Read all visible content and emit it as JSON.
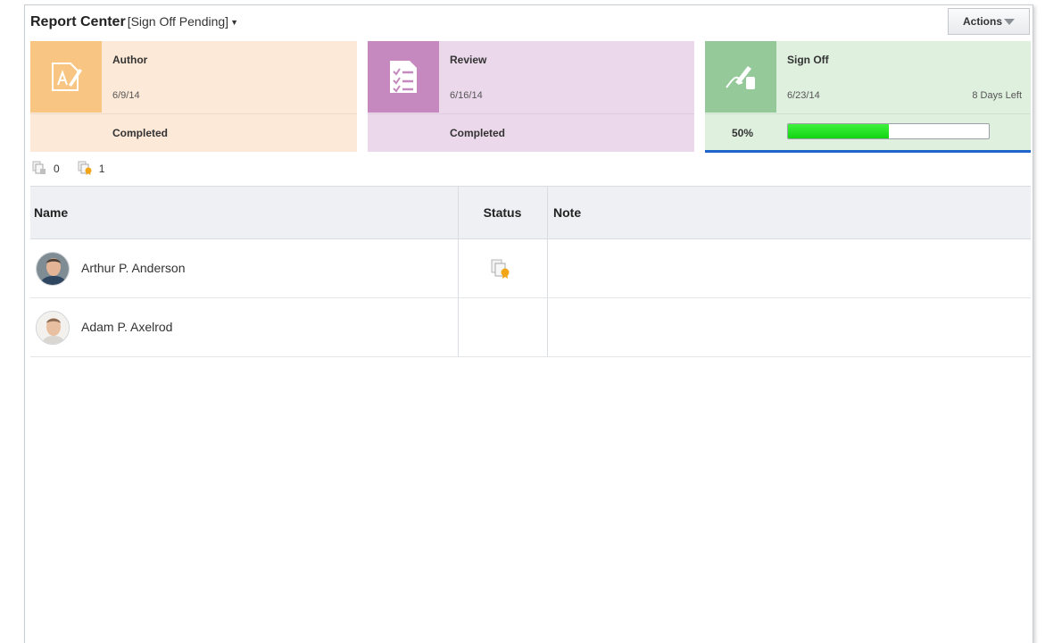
{
  "header": {
    "title": "Report Center",
    "subtitle": "[Sign Off Pending]",
    "actions_label": "Actions"
  },
  "stages": [
    {
      "name": "Author",
      "date": "6/9/14",
      "status": "Completed",
      "icon": "author-edit-icon",
      "color": "#f8c583",
      "bg": "#fde9d8"
    },
    {
      "name": "Review",
      "date": "6/16/14",
      "status": "Completed",
      "icon": "checklist-icon",
      "color": "#c589bf",
      "bg": "#ebd9eb"
    },
    {
      "name": "Sign Off",
      "date": "6/23/14",
      "days_left": "8 Days Left",
      "progress_label": "50%",
      "progress": 0.5,
      "icon": "signature-icon",
      "color": "#95c99a",
      "bg": "#dff0df",
      "active_color": "#1f64c8"
    }
  ],
  "counts": [
    {
      "icon": "pending-documents-icon",
      "value": "0"
    },
    {
      "icon": "signed-documents-icon",
      "value": "1"
    }
  ],
  "table": {
    "columns": [
      "Name",
      "Status",
      "Note"
    ],
    "rows": [
      {
        "name": "Arthur P. Anderson",
        "status_icon": "signed-document-icon",
        "note": ""
      },
      {
        "name": "Adam P. Axelrod",
        "status_icon": "",
        "note": ""
      }
    ]
  }
}
